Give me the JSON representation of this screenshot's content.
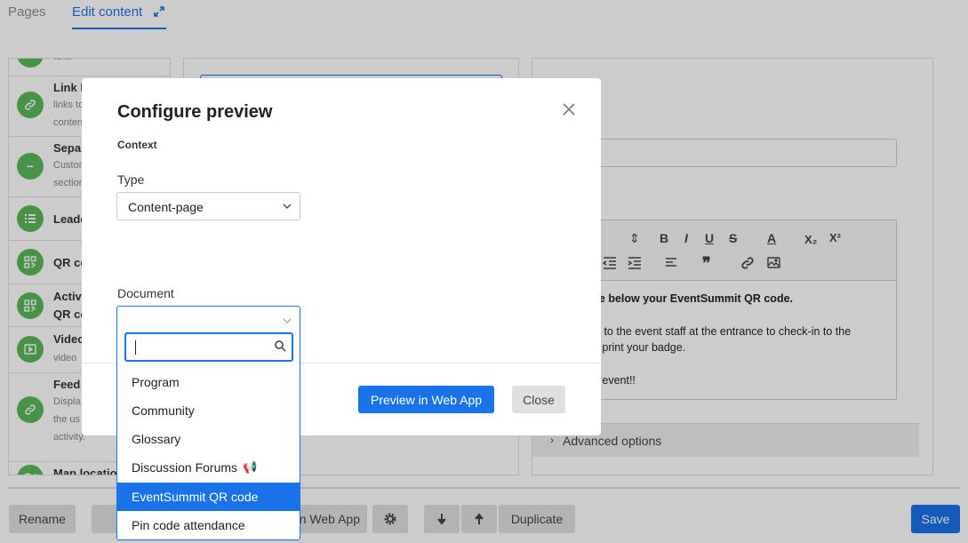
{
  "tabs": [
    {
      "label": "Pages"
    },
    {
      "label": "Edit content"
    }
  ],
  "left_panel": {
    "items": [
      {
        "title": "",
        "desc": "text.",
        "icon": "check-icon"
      },
      {
        "title": "Link l",
        "desc_lines": [
          "links to",
          "conten"
        ],
        "icon": "link-icon"
      },
      {
        "title": "Separ",
        "desc_lines": [
          "Custom",
          "section"
        ],
        "icon": "minus-icon"
      },
      {
        "title": "Leade",
        "icon": "list-icon"
      },
      {
        "title": "QR co",
        "icon": "qr-icon"
      },
      {
        "title": "Activa",
        "title2": "QR co",
        "icon": "qr-icon"
      },
      {
        "title": "Video",
        "desc": "video",
        "icon": "video-icon"
      },
      {
        "title": "Feed",
        "desc_lines": [
          "Displa",
          "the us",
          "activity."
        ],
        "icon": "link-icon"
      },
      {
        "title": "Map location",
        "icon": "map-icon"
      }
    ]
  },
  "editor": {
    "toolbar_row1": [
      "B",
      "I",
      "U",
      "S",
      "A",
      "X₂",
      "X²"
    ],
    "content": {
      "line1": "see below your EventSummit QR code.",
      "line2": "his to the event staff at the entrance to check-in to the",
      "line3": "nd print your badge.",
      "line4": "he event!!"
    },
    "advanced_options": "Advanced options"
  },
  "bottom_bar": {
    "rename": "Rename",
    "webapp": "n Web App",
    "duplicate": "Duplicate",
    "save": "Save"
  },
  "modal": {
    "title": "Configure preview",
    "context_label": "Context",
    "type_label": "Type",
    "type_value": "Content-page",
    "document_label": "Document",
    "search_value": "",
    "options": [
      {
        "label": "Program"
      },
      {
        "label": "Community"
      },
      {
        "label": "Glossary"
      },
      {
        "label": "Discussion Forums"
      },
      {
        "label": "EventSummit QR code",
        "selected": true
      },
      {
        "label": "Pin code attendance"
      }
    ],
    "preview_button": "Preview in Web App",
    "close_button": "Close"
  },
  "colors": {
    "accent": "#1a73e8",
    "icon_green": "#5cb85c"
  }
}
